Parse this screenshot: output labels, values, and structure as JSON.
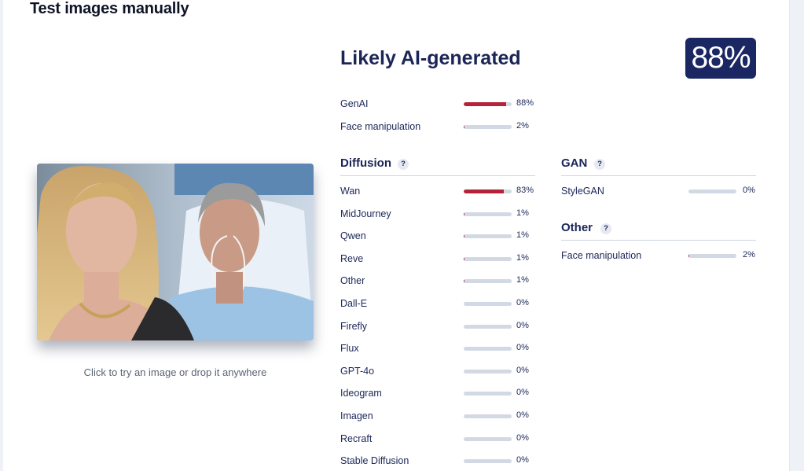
{
  "page": {
    "title": "Test images manually"
  },
  "result": {
    "verdict": "Likely AI-generated",
    "score": "88%",
    "accent_color": "#1b2762",
    "bar_fill_color": "#b3243a",
    "bar_track_color": "#d3d9e4"
  },
  "upload": {
    "hint": "Click to try an image or drop it anywhere"
  },
  "summary": [
    {
      "label": "GenAI",
      "pct": "88%",
      "value": 88
    },
    {
      "label": "Face manipulation",
      "pct": "2%",
      "value": 2
    }
  ],
  "diffusion": {
    "title": "Diffusion",
    "help": "?",
    "items": [
      {
        "label": "Wan",
        "pct": "83%",
        "value": 83
      },
      {
        "label": "MidJourney",
        "pct": "1%",
        "value": 1
      },
      {
        "label": "Qwen",
        "pct": "1%",
        "value": 1
      },
      {
        "label": "Reve",
        "pct": "1%",
        "value": 1
      },
      {
        "label": "Other",
        "pct": "1%",
        "value": 1
      },
      {
        "label": "Dall-E",
        "pct": "0%",
        "value": 0
      },
      {
        "label": "Firefly",
        "pct": "0%",
        "value": 0
      },
      {
        "label": "Flux",
        "pct": "0%",
        "value": 0
      },
      {
        "label": "GPT-4o",
        "pct": "0%",
        "value": 0
      },
      {
        "label": "Ideogram",
        "pct": "0%",
        "value": 0
      },
      {
        "label": "Imagen",
        "pct": "0%",
        "value": 0
      },
      {
        "label": "Recraft",
        "pct": "0%",
        "value": 0
      },
      {
        "label": "Stable Diffusion",
        "pct": "0%",
        "value": 0
      }
    ]
  },
  "gan": {
    "title": "GAN",
    "help": "?",
    "items": [
      {
        "label": "StyleGAN",
        "pct": "0%",
        "value": 0
      }
    ]
  },
  "other": {
    "title": "Other",
    "help": "?",
    "items": [
      {
        "label": "Face manipulation",
        "pct": "2%",
        "value": 2
      }
    ]
  }
}
